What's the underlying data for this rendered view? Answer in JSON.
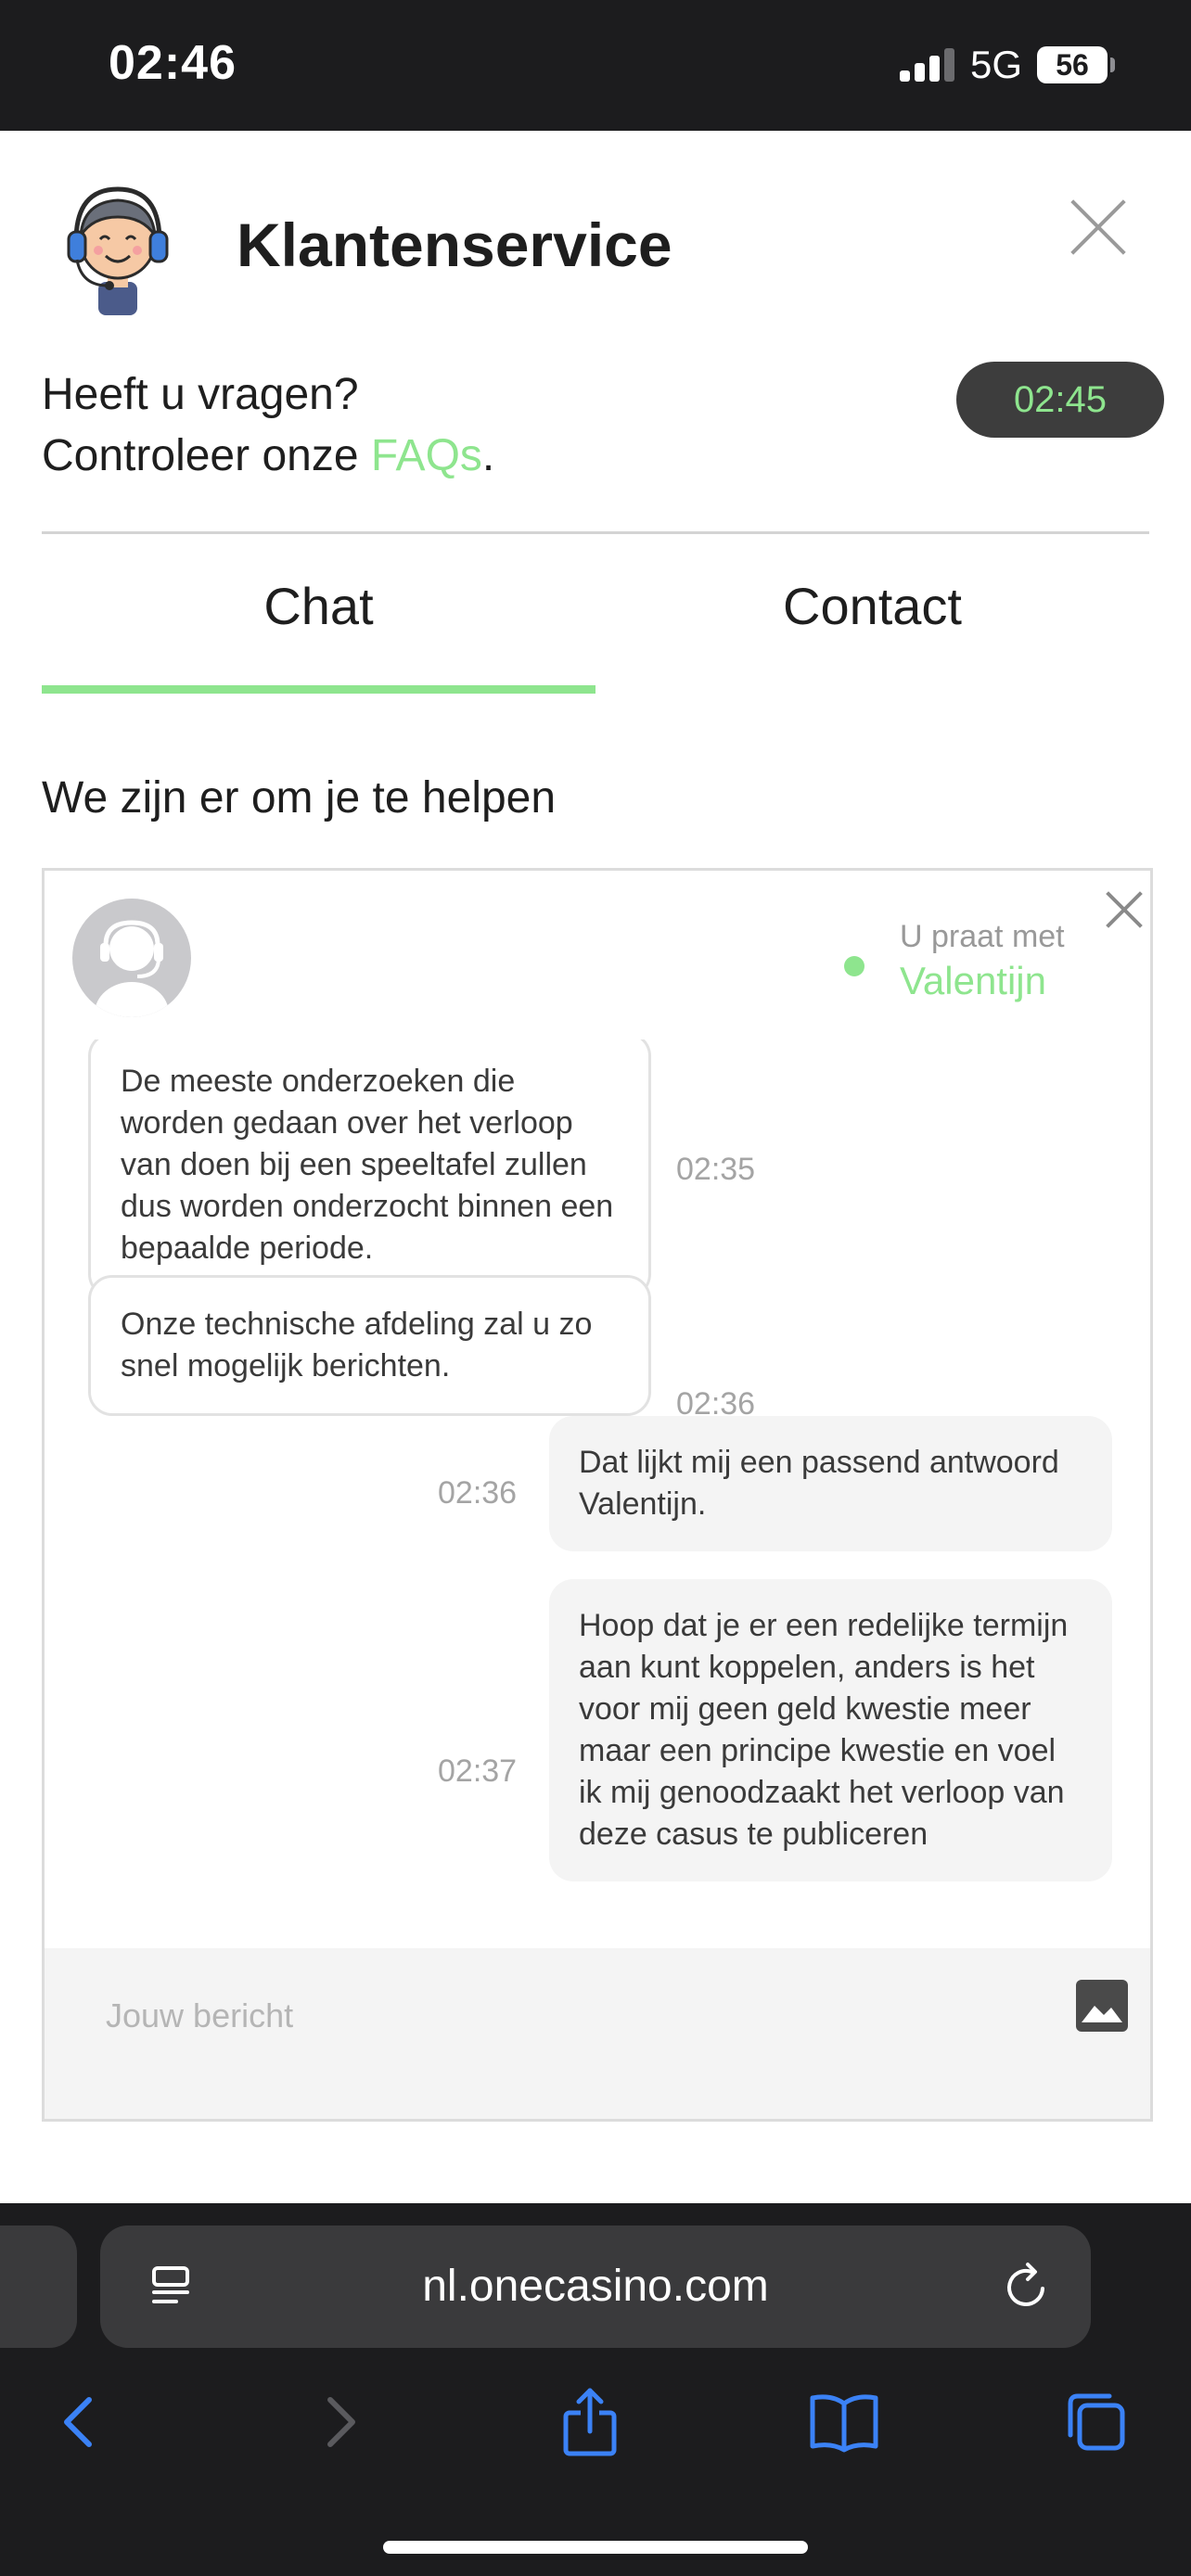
{
  "status_bar": {
    "time": "02:46",
    "network": "5G",
    "battery": "56"
  },
  "header": {
    "title": "Klantenservice"
  },
  "intro": {
    "line1": "Heeft u vragen?",
    "line2_prefix": "Controleer onze ",
    "faq_link": "FAQs",
    "line2_suffix": ".",
    "session_time": "02:45"
  },
  "tabs": [
    {
      "label": "Chat",
      "active": true
    },
    {
      "label": "Contact",
      "active": false
    }
  ],
  "help_text": "We zijn er om je te helpen",
  "chat": {
    "talking_with_label": "U praat met",
    "agent_name": "Valentijn",
    "messages": [
      {
        "direction": "incoming",
        "text": "De meeste onderzoeken die worden gedaan over het verloop van doen bij een speeltafel zullen dus worden onderzocht binnen een bepaalde periode.",
        "time": "02:35"
      },
      {
        "direction": "incoming",
        "text": "Onze technische afdeling zal u zo snel mogelijk berichten.",
        "time": "02:36"
      },
      {
        "direction": "outgoing",
        "text": "Dat lijkt mij een passend antwoord Valentijn.",
        "time": "02:36"
      },
      {
        "direction": "outgoing",
        "text": "Hoop dat je er een redelijke termijn aan kunt koppelen, anders is het voor mij geen geld kwestie meer maar een principe kwestie en voel ik mij genoodzaakt het verloop van deze casus te publiceren",
        "time": "02:37"
      }
    ],
    "input_placeholder": "Jouw bericht"
  },
  "browser": {
    "url": "nl.onecasino.com"
  },
  "colors": {
    "accent": "#8ee58e",
    "browser_blue": "#3b82f6"
  }
}
